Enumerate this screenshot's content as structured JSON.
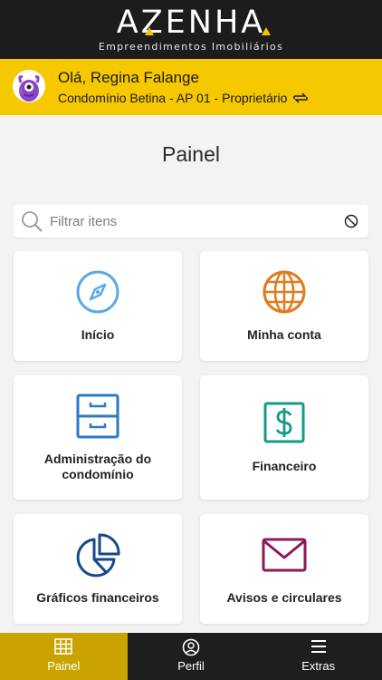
{
  "brand": {
    "name": "AZENHA",
    "subtitle": "Empreendimentos Imobiliários"
  },
  "user": {
    "greeting": "Olá, Regina Falange",
    "condo": "Condomínio Betina - AP 01 - Proprietário",
    "avatar_icon": "purple-monster-avatar",
    "switch_icon": "swap-arrows-icon"
  },
  "page": {
    "title": "Painel"
  },
  "search": {
    "placeholder": "Filtrar itens",
    "value": ""
  },
  "cards": [
    {
      "label": "Início",
      "icon": "compass-icon",
      "color": "#5aa9e6"
    },
    {
      "label": "Minha conta",
      "icon": "globe-icon",
      "color": "#e07b1e"
    },
    {
      "label": "Administração do condomínio",
      "icon": "filing-cabinet-icon",
      "color": "#2e79c7"
    },
    {
      "label": "Financeiro",
      "icon": "dollar-sign-icon",
      "color": "#139b8a"
    },
    {
      "label": "Gráficos financeiros",
      "icon": "pie-chart-icon",
      "color": "#174a8c"
    },
    {
      "label": "Avisos e circulares",
      "icon": "envelope-icon",
      "color": "#8a1a5e"
    }
  ],
  "nav": [
    {
      "label": "Painel",
      "icon": "grid-icon",
      "active": true
    },
    {
      "label": "Perfil",
      "icon": "user-circle-icon",
      "active": false
    },
    {
      "label": "Extras",
      "icon": "menu-icon",
      "active": false
    }
  ],
  "colors": {
    "header_bg": "#1c1c1c",
    "accent_yellow": "#f5c800",
    "active_tab": "#c9a400"
  }
}
